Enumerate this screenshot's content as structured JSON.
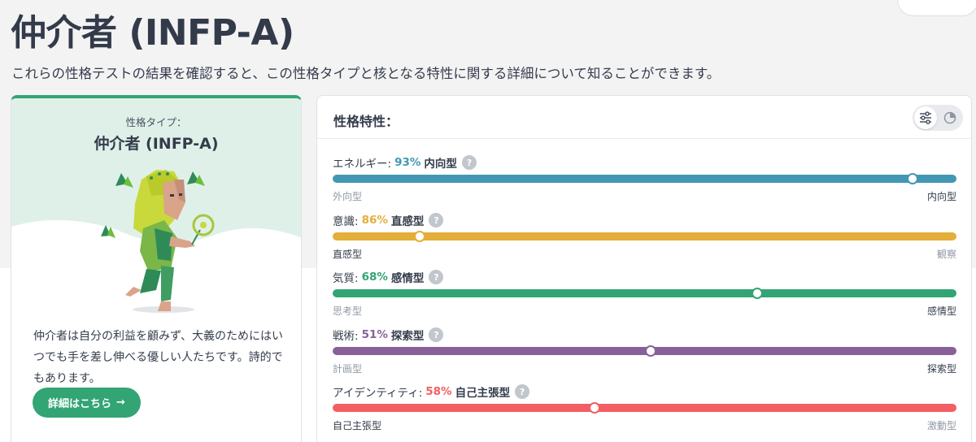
{
  "page": {
    "title": "仲介者 (INFP-A)",
    "subtitle": "これらの性格テストの結果を確認すると、この性格タイプと核となる特性に関する詳細について知ることができます。"
  },
  "type_card": {
    "label": "性格タイプ：",
    "name": "仲介者 (INFP-A)",
    "description": "仲介者は自分の利益を顧みず、大義のためにはいつでも手を差し伸べる優しい人たちです。詩的でもあります。",
    "cta_label": "詳細はこちら",
    "cta_arrow": "→",
    "accent_color": "#33a474",
    "illustration": "mediator-figure-illustration"
  },
  "traits_card": {
    "title": "性格特性：",
    "view_toggle": {
      "icons": [
        "sliders-icon",
        "pie-chart-icon"
      ],
      "active": "sliders-icon"
    },
    "help_glyph": "?",
    "traits": [
      {
        "category": "エネルギー:",
        "percent_label": "93%",
        "trait": "内向型",
        "value": 0.93,
        "color": "#4298b4",
        "left_pole": "外向型",
        "right_pole": "内向型",
        "dominant": "right"
      },
      {
        "category": "意識:",
        "percent_label": "86%",
        "trait": "直感型",
        "value": 0.14,
        "color": "#e4ae3a",
        "left_pole": "直感型",
        "right_pole": "観察",
        "dominant": "left"
      },
      {
        "category": "気質:",
        "percent_label": "68%",
        "trait": "感情型",
        "value": 0.68,
        "color": "#33a474",
        "left_pole": "思考型",
        "right_pole": "感情型",
        "dominant": "right"
      },
      {
        "category": "戦術:",
        "percent_label": "51%",
        "trait": "探索型",
        "value": 0.51,
        "color": "#88619a",
        "left_pole": "計画型",
        "right_pole": "探索型",
        "dominant": "right"
      },
      {
        "category": "アイデンティティ:",
        "percent_label": "58%",
        "trait": "自己主張型",
        "value": 0.42,
        "color": "#f25e62",
        "left_pole": "自己主張型",
        "right_pole": "激動型",
        "dominant": "left"
      }
    ]
  }
}
